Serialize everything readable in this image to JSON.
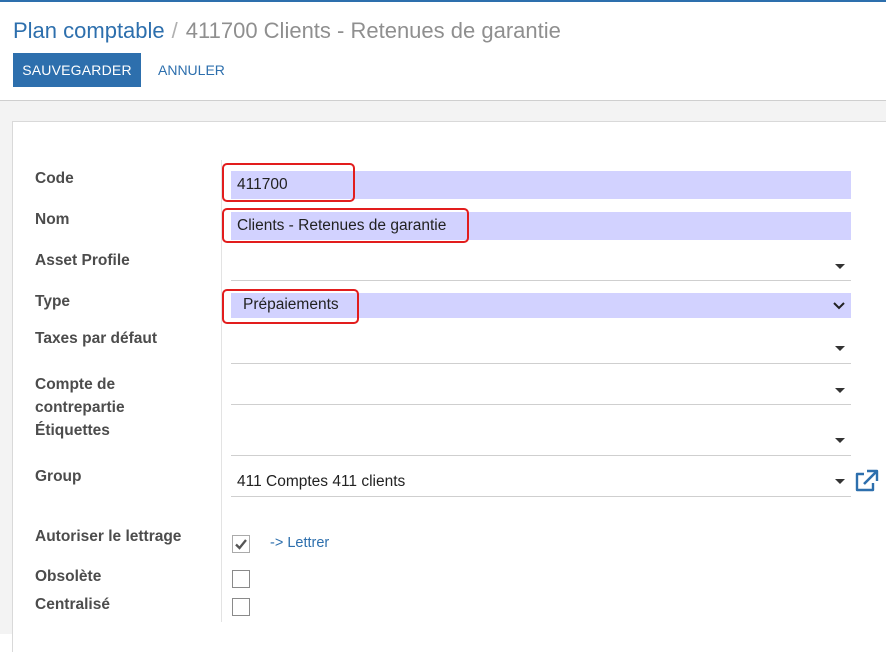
{
  "breadcrumb": {
    "parent": "Plan comptable",
    "separator": "/",
    "current": "411700 Clients - Retenues de garantie"
  },
  "buttons": {
    "save": "SAUVEGARDER",
    "cancel": "ANNULER"
  },
  "form": {
    "code": {
      "label": "Code",
      "value": "411700"
    },
    "nom": {
      "label": "Nom",
      "value": "Clients - Retenues de garantie"
    },
    "asset_profile": {
      "label": "Asset Profile",
      "value": ""
    },
    "type": {
      "label": "Type",
      "value": "Prépaiements"
    },
    "taxes": {
      "label": "Taxes par défaut",
      "value": ""
    },
    "compte_contrepartie": {
      "label_line1": "Compte de",
      "label_line2": "contrepartie",
      "value": ""
    },
    "etiquettes": {
      "label": "Étiquettes",
      "value": ""
    },
    "group": {
      "label": "Group",
      "value": "411 Comptes 411 clients"
    },
    "lettrage": {
      "label": "Autoriser le lettrage",
      "checked": true,
      "link": "-> Lettrer"
    },
    "obsolete": {
      "label": "Obsolète",
      "checked": false
    },
    "centralise": {
      "label": "Centralisé",
      "checked": false
    }
  },
  "icons": {
    "dropdown": "caret-down-icon",
    "select_chevron": "chevron-down-icon",
    "external": "external-link-icon",
    "check": "check-icon"
  },
  "colors": {
    "primary": "#2d6fad",
    "required_field_bg": "#d2d2ff",
    "highlight": "#e21d1d"
  }
}
